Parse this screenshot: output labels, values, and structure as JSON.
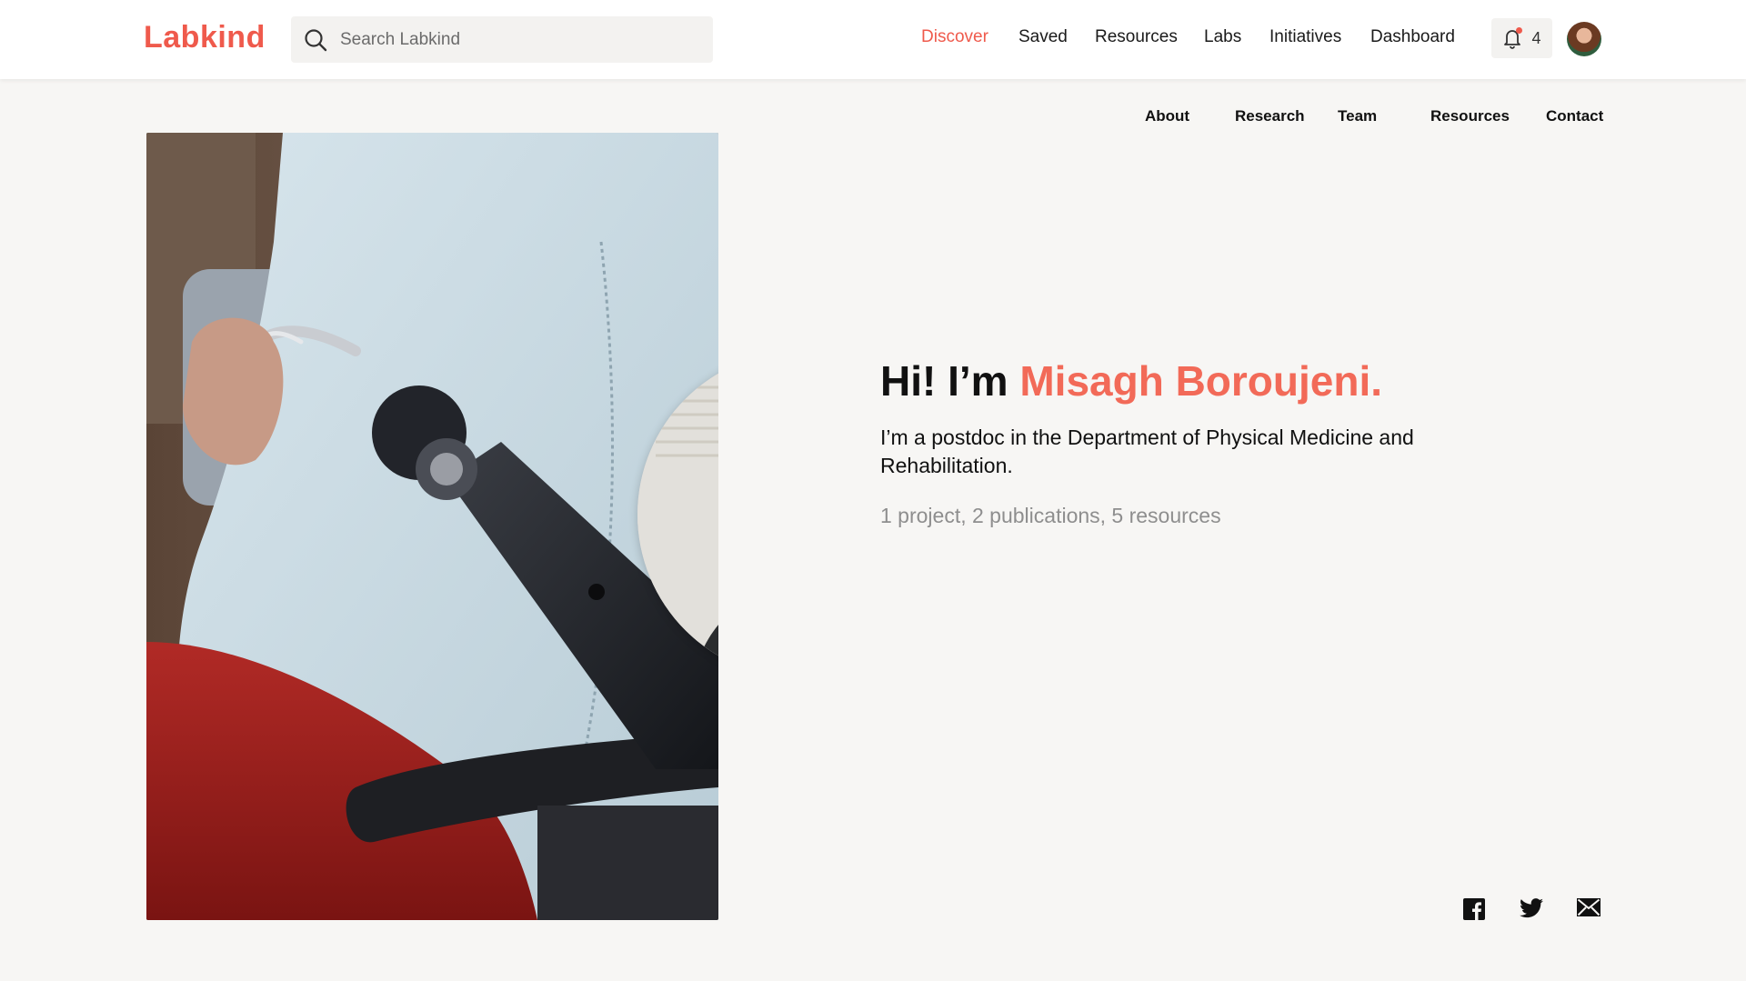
{
  "header": {
    "logo": "Labkind",
    "search_placeholder": "Search Labkind",
    "nav": [
      {
        "label": "Discover",
        "active": true
      },
      {
        "label": "Saved"
      },
      {
        "label": "Resources"
      },
      {
        "label": "Labs"
      },
      {
        "label": "Initiatives"
      },
      {
        "label": "Dashboard"
      }
    ],
    "notifications_count": "4"
  },
  "profile_nav": [
    "About",
    "Research",
    "Team",
    "Resources",
    "Contact"
  ],
  "hero": {
    "greeting_prefix": "Hi! I’m ",
    "name": "Misagh Boroujeni.",
    "bio": "I’m a postdoc in the Department of Physical Medicine and Rehabilitation.",
    "stats": "1 project, 2 publications, 5 resources"
  },
  "social": [
    "facebook-icon",
    "twitter-icon",
    "mail-icon"
  ],
  "colors": {
    "accent": "#ef5a4c",
    "name_accent": "#f26a58",
    "page_bg": "#f7f6f4",
    "muted_text": "#8e8e8e"
  }
}
